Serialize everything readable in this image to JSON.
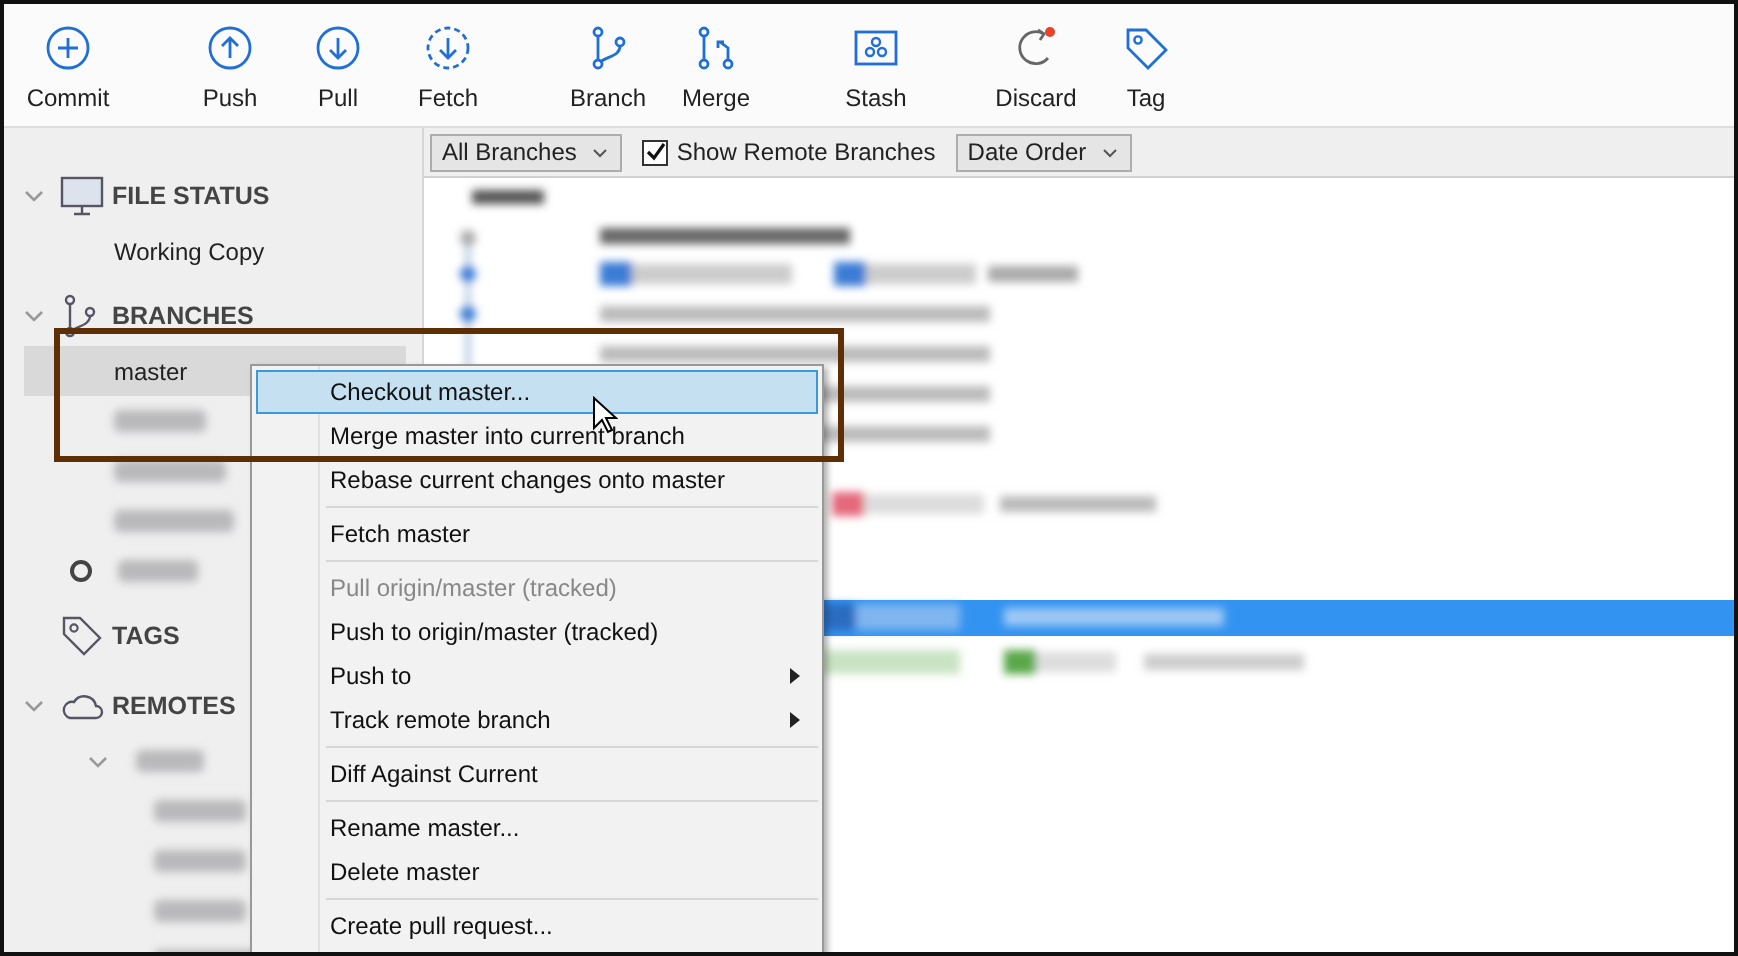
{
  "toolbar": [
    {
      "label": "Commit"
    },
    {
      "label": "Push"
    },
    {
      "label": "Pull"
    },
    {
      "label": "Fetch"
    },
    {
      "label": "Branch"
    },
    {
      "label": "Merge"
    },
    {
      "label": "Stash"
    },
    {
      "label": "Discard"
    },
    {
      "label": "Tag"
    }
  ],
  "filter_bar": {
    "branch_filter": "All Branches",
    "show_remote": {
      "label": "Show Remote Branches",
      "checked": true
    },
    "order": "Date Order"
  },
  "sidebar": {
    "sections": [
      {
        "title": "FILE STATUS",
        "expanded": true,
        "items": [
          {
            "label": "Working Copy",
            "selected": false
          }
        ]
      },
      {
        "title": "BRANCHES",
        "expanded": true,
        "items": [
          {
            "label": "master",
            "selected": true,
            "current": false
          },
          {
            "kind": "redacted",
            "selected": false,
            "current": false
          },
          {
            "kind": "redacted",
            "selected": false,
            "current": false
          },
          {
            "kind": "redacted",
            "selected": false,
            "current": false
          },
          {
            "kind": "redacted",
            "selected": false,
            "current": true
          }
        ]
      },
      {
        "title": "TAGS"
      },
      {
        "title": "REMOTES",
        "expanded": true,
        "items": [
          {
            "kind": "redacted",
            "selected": false,
            "expanded": true,
            "children": [
              {
                "kind": "redacted",
                "selected": false
              },
              {
                "kind": "redacted",
                "selected": false
              },
              {
                "kind": "redacted",
                "selected": false
              },
              {
                "kind": "redacted",
                "selected": false
              }
            ]
          }
        ]
      }
    ]
  },
  "context_menu": {
    "items": [
      {
        "kind": "item",
        "label": "Checkout master...",
        "selected": true,
        "disabled": false,
        "submenu": false
      },
      {
        "kind": "item",
        "label": "Merge master into current branch",
        "selected": false,
        "disabled": false,
        "submenu": false
      },
      {
        "kind": "item",
        "label": "Rebase current changes onto master",
        "selected": false,
        "disabled": false,
        "submenu": false
      },
      {
        "kind": "separator"
      },
      {
        "kind": "item",
        "label": "Fetch master",
        "selected": false,
        "disabled": false,
        "submenu": false
      },
      {
        "kind": "separator"
      },
      {
        "kind": "item",
        "label": "Pull origin/master (tracked)",
        "selected": false,
        "disabled": true,
        "submenu": false
      },
      {
        "kind": "item",
        "label": "Push to origin/master (tracked)",
        "selected": false,
        "disabled": false,
        "submenu": false
      },
      {
        "kind": "item",
        "label": "Push to",
        "selected": false,
        "disabled": false,
        "submenu": true
      },
      {
        "kind": "item",
        "label": "Track remote branch",
        "selected": false,
        "disabled": false,
        "submenu": true
      },
      {
        "kind": "separator"
      },
      {
        "kind": "item",
        "label": "Diff Against Current",
        "selected": false,
        "disabled": false,
        "submenu": false
      },
      {
        "kind": "separator"
      },
      {
        "kind": "item",
        "label": "Rename master...",
        "selected": false,
        "disabled": false,
        "submenu": false
      },
      {
        "kind": "item",
        "label": "Delete master",
        "selected": false,
        "disabled": false,
        "submenu": false
      },
      {
        "kind": "separator"
      },
      {
        "kind": "item",
        "label": "Create pull request...",
        "selected": false,
        "disabled": false,
        "submenu": false
      }
    ]
  }
}
